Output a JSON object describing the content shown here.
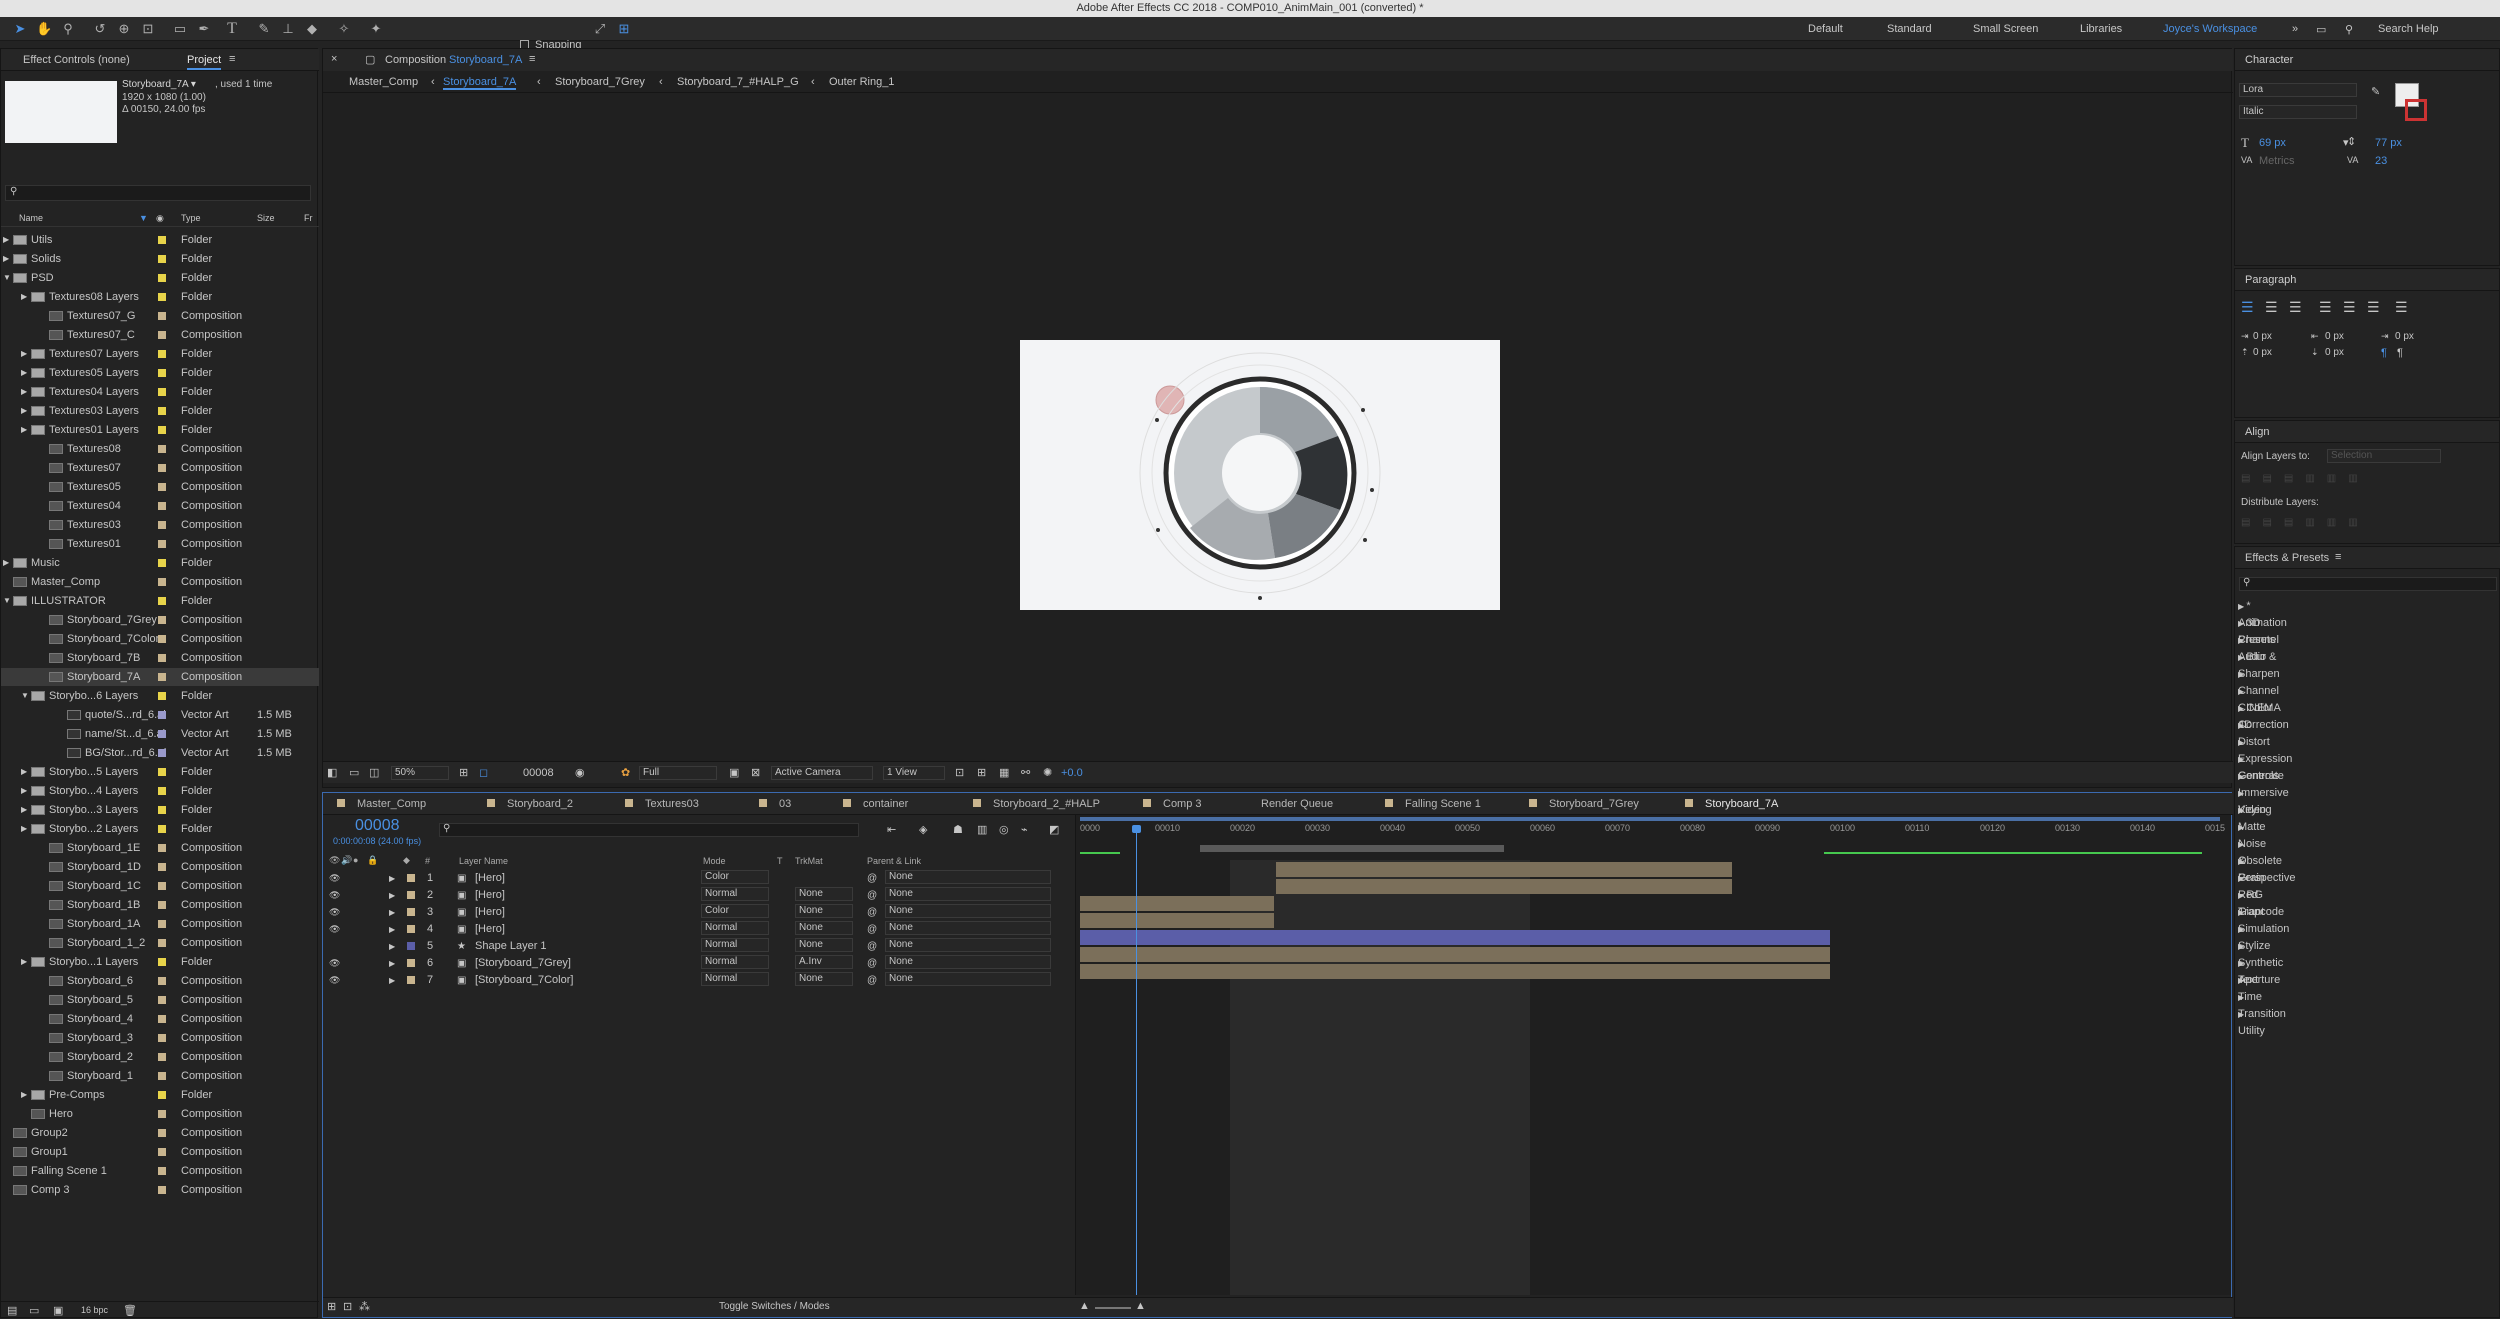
{
  "window_title": "Adobe After Effects CC 2018 - COMP010_AnimMain_001 (converted) *",
  "toolbar": {
    "snapping": "Snapping"
  },
  "workspaces": [
    "Default",
    "Standard",
    "Small Screen",
    "Libraries",
    "Joyce's Workspace"
  ],
  "search_help": "Search Help",
  "left_panel": {
    "tab_effect_controls": "Effect Controls (none)",
    "tab_project": "Project",
    "selected_item": {
      "name": "Storyboard_7A ▾",
      "used": ", used 1 time",
      "res": "1920 x 1080 (1.00)",
      "dur": "Δ 00150, 24.00 fps"
    },
    "columns": [
      "Name",
      "Type",
      "Size",
      "Fr"
    ],
    "items": [
      {
        "name": "Utils",
        "type": "Folder",
        "size": "",
        "color": "#e8d44a"
      },
      {
        "name": "Solids",
        "type": "Folder",
        "size": "",
        "color": "#e8d44a"
      },
      {
        "name": "PSD",
        "type": "Folder",
        "size": "",
        "color": "#e8d44a"
      },
      {
        "name": "Textures08 Layers",
        "type": "Folder",
        "size": "",
        "color": "#e8d44a"
      },
      {
        "name": "Textures07_G",
        "type": "Composition",
        "size": "",
        "color": "#c9b58f"
      },
      {
        "name": "Textures07_C",
        "type": "Composition",
        "size": "",
        "color": "#c9b58f"
      },
      {
        "name": "Textures07 Layers",
        "type": "Folder",
        "size": "",
        "color": "#e8d44a"
      },
      {
        "name": "Textures05 Layers",
        "type": "Folder",
        "size": "",
        "color": "#e8d44a"
      },
      {
        "name": "Textures04 Layers",
        "type": "Folder",
        "size": "",
        "color": "#e8d44a"
      },
      {
        "name": "Textures03 Layers",
        "type": "Folder",
        "size": "",
        "color": "#e8d44a"
      },
      {
        "name": "Textures01 Layers",
        "type": "Folder",
        "size": "",
        "color": "#e8d44a"
      },
      {
        "name": "Textures08",
        "type": "Composition",
        "size": "",
        "color": "#c9b58f"
      },
      {
        "name": "Textures07",
        "type": "Composition",
        "size": "",
        "color": "#c9b58f"
      },
      {
        "name": "Textures05",
        "type": "Composition",
        "size": "",
        "color": "#c9b58f"
      },
      {
        "name": "Textures04",
        "type": "Composition",
        "size": "",
        "color": "#c9b58f"
      },
      {
        "name": "Textures03",
        "type": "Composition",
        "size": "",
        "color": "#c9b58f"
      },
      {
        "name": "Textures01",
        "type": "Composition",
        "size": "",
        "color": "#c9b58f"
      },
      {
        "name": "Music",
        "type": "Folder",
        "size": "",
        "color": "#e8d44a"
      },
      {
        "name": "Master_Comp",
        "type": "Composition",
        "size": "",
        "color": "#c9b58f"
      },
      {
        "name": "ILLUSTRATOR",
        "type": "Folder",
        "size": "",
        "color": "#e8d44a"
      },
      {
        "name": "Storyboard_7Grey",
        "type": "Composition",
        "size": "",
        "color": "#c9b58f"
      },
      {
        "name": "Storyboard_7Color",
        "type": "Composition",
        "size": "",
        "color": "#c9b58f"
      },
      {
        "name": "Storyboard_7B",
        "type": "Composition",
        "size": "",
        "color": "#c9b58f"
      },
      {
        "name": "Storyboard_7A",
        "type": "Composition",
        "size": "",
        "color": "#c9b58f"
      },
      {
        "name": "Storybo...6 Layers",
        "type": "Folder",
        "size": "",
        "color": "#e8d44a"
      },
      {
        "name": "quote/S...rd_6.ai",
        "type": "Vector Art",
        "size": "1.5 MB",
        "color": "#9a9acb"
      },
      {
        "name": "name/St...d_6.ai",
        "type": "Vector Art",
        "size": "1.5 MB",
        "color": "#9a9acb"
      },
      {
        "name": "BG/Stor...rd_6.ai",
        "type": "Vector Art",
        "size": "1.5 MB",
        "color": "#9a9acb"
      },
      {
        "name": "Storybo...5 Layers",
        "type": "Folder",
        "size": "",
        "color": "#e8d44a"
      },
      {
        "name": "Storybo...4 Layers",
        "type": "Folder",
        "size": "",
        "color": "#e8d44a"
      },
      {
        "name": "Storybo...3 Layers",
        "type": "Folder",
        "size": "",
        "color": "#e8d44a"
      },
      {
        "name": "Storybo...2 Layers",
        "type": "Folder",
        "size": "",
        "color": "#e8d44a"
      },
      {
        "name": "Storyboard_1E",
        "type": "Composition",
        "size": "",
        "color": "#c9b58f"
      },
      {
        "name": "Storyboard_1D",
        "type": "Composition",
        "size": "",
        "color": "#c9b58f"
      },
      {
        "name": "Storyboard_1C",
        "type": "Composition",
        "size": "",
        "color": "#c9b58f"
      },
      {
        "name": "Storyboard_1B",
        "type": "Composition",
        "size": "",
        "color": "#c9b58f"
      },
      {
        "name": "Storyboard_1A",
        "type": "Composition",
        "size": "",
        "color": "#c9b58f"
      },
      {
        "name": "Storyboard_1_2",
        "type": "Composition",
        "size": "",
        "color": "#c9b58f"
      },
      {
        "name": "Storybo...1 Layers",
        "type": "Folder",
        "size": "",
        "color": "#e8d44a"
      },
      {
        "name": "Storyboard_6",
        "type": "Composition",
        "size": "",
        "color": "#c9b58f"
      },
      {
        "name": "Storyboard_5",
        "type": "Composition",
        "size": "",
        "color": "#c9b58f"
      },
      {
        "name": "Storyboard_4",
        "type": "Composition",
        "size": "",
        "color": "#c9b58f"
      },
      {
        "name": "Storyboard_3",
        "type": "Composition",
        "size": "",
        "color": "#c9b58f"
      },
      {
        "name": "Storyboard_2",
        "type": "Composition",
        "size": "",
        "color": "#c9b58f"
      },
      {
        "name": "Storyboard_1",
        "type": "Composition",
        "size": "",
        "color": "#c9b58f"
      },
      {
        "name": "Pre-Comps",
        "type": "Folder",
        "size": "",
        "color": "#e8d44a"
      },
      {
        "name": "Hero",
        "type": "Composition",
        "size": "",
        "color": "#c9b58f"
      },
      {
        "name": "Group2",
        "type": "Composition",
        "size": "",
        "color": "#c9b58f"
      },
      {
        "name": "Group1",
        "type": "Composition",
        "size": "",
        "color": "#c9b58f"
      },
      {
        "name": "Falling Scene 1",
        "type": "Composition",
        "size": "",
        "color": "#c9b58f"
      },
      {
        "name": "Comp 3",
        "type": "Composition",
        "size": "",
        "color": "#c9b58f"
      }
    ],
    "bpc": "16 bpc"
  },
  "composition": {
    "header": "Composition",
    "header_name": "Storyboard_7A",
    "breadcrumbs": [
      "Master_Comp",
      "Storyboard_7A",
      "Storyboard_7Grey",
      "Storyboard_7_#HALP_G",
      "Outer Ring_1"
    ],
    "zoom": "50%",
    "timecode": "00008",
    "resolution": "Full",
    "camera": "Active Camera",
    "views": "1 View",
    "exposure": "+0.0"
  },
  "timeline": {
    "tabs": [
      "Master_Comp",
      "Storyboard_2",
      "Textures03",
      "03",
      "container",
      "Storyboard_2_#HALP",
      "Comp 3",
      "Render Queue",
      "Falling Scene 1",
      "Storyboard_7Grey",
      "Storyboard_7A"
    ],
    "current_time": "00008",
    "current_time_sub": "0:00:00:08 (24.00 fps)",
    "col_headers": {
      "num": "#",
      "layer": "Layer Name",
      "mode": "Mode",
      "t": "T",
      "trkmat": "TrkMat",
      "parent": "Parent & Link"
    },
    "ruler": [
      "0000",
      "00010",
      "00020",
      "00030",
      "00040",
      "00050",
      "00060",
      "00070",
      "00080",
      "00090",
      "00100",
      "00110",
      "00120",
      "00130",
      "00140",
      "0015"
    ],
    "layers": [
      {
        "num": "1",
        "name": "[Hero]",
        "mode": "Color",
        "trkmat": "",
        "parent": "None"
      },
      {
        "num": "2",
        "name": "[Hero]",
        "mode": "Normal",
        "trkmat": "None",
        "parent": "None"
      },
      {
        "num": "3",
        "name": "[Hero]",
        "mode": "Color",
        "trkmat": "None",
        "parent": "None"
      },
      {
        "num": "4",
        "name": "[Hero]",
        "mode": "Normal",
        "trkmat": "None",
        "parent": "None"
      },
      {
        "num": "5",
        "name": "Shape Layer 1",
        "mode": "Normal",
        "trkmat": "None",
        "parent": "None"
      },
      {
        "num": "6",
        "name": "[Storyboard_7Grey]",
        "mode": "Normal",
        "trkmat": "A.Inv",
        "parent": "None"
      },
      {
        "num": "7",
        "name": "[Storyboard_7Color]",
        "mode": "Normal",
        "trkmat": "None",
        "parent": "None"
      }
    ],
    "toggle": "Toggle Switches / Modes"
  },
  "character": {
    "title": "Character",
    "font": "Lora",
    "style": "Italic",
    "size": "69 px",
    "leading": "77 px",
    "kerning": "Metrics",
    "tracking": "23"
  },
  "paragraph": {
    "title": "Paragraph",
    "vals": [
      "0 px",
      "0 px",
      "0 px",
      "0 px",
      "0 px"
    ]
  },
  "align": {
    "title": "Align",
    "align_to_label": "Align Layers to:",
    "align_to": "Selection",
    "distribute": "Distribute Layers:"
  },
  "effects": {
    "title": "Effects & Presets",
    "items": [
      "* Animation Presets",
      "3D Channel",
      "Audio",
      "Blur & Sharpen",
      "Channel",
      "CINEMA 4D",
      "Color Correction",
      "Distort",
      "Expression Controls",
      "Generate",
      "Immersive Video",
      "Keying",
      "Matte",
      "Noise & Grain",
      "Obsolete",
      "Perspective",
      "Red Giant",
      "RG Trapcode",
      "Simulation",
      "Stylize",
      "Synthetic Aperture",
      "Text",
      "Time",
      "Transition",
      "Utility"
    ]
  }
}
